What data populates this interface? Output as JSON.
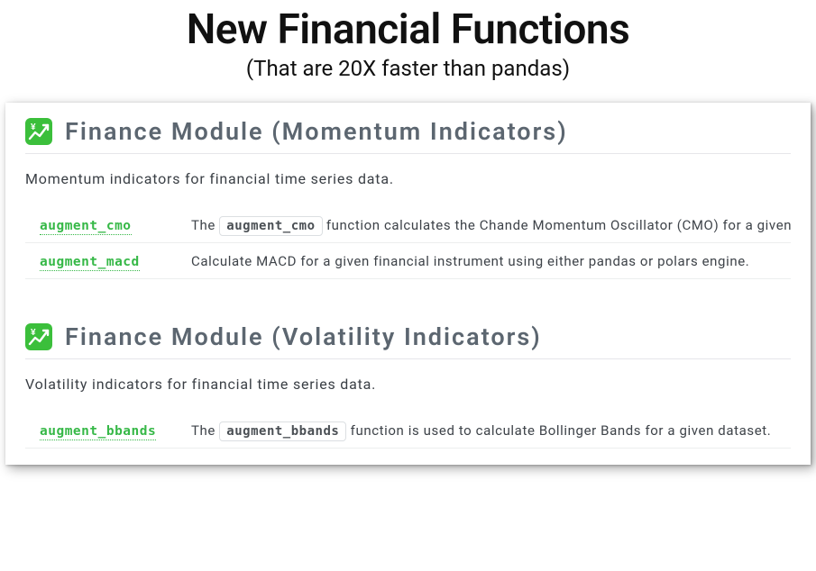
{
  "header": {
    "title": "New Financial Functions",
    "subtitle": "(That are 20X faster than pandas)"
  },
  "sections": [
    {
      "icon": "chart-yen-icon",
      "title": "Finance Module (Momentum Indicators)",
      "description": "Momentum indicators for financial time series data.",
      "functions": [
        {
          "name": "augment_cmo",
          "desc_prefix": "The ",
          "code": "augment_cmo",
          "desc_suffix": " function calculates the Chande Momentum Oscillator (CMO) for a given financial time series."
        },
        {
          "name": "augment_macd",
          "desc_prefix": "",
          "code": "",
          "desc_suffix": "Calculate MACD for a given financial instrument using either pandas or polars engine."
        }
      ]
    },
    {
      "icon": "chart-yen-icon",
      "title": "Finance Module (Volatility Indicators)",
      "description": "Volatility indicators for financial time series data.",
      "functions": [
        {
          "name": "augment_bbands",
          "desc_prefix": "The ",
          "code": "augment_bbands",
          "desc_suffix": " function is used to calculate Bollinger Bands for a given dataset."
        }
      ]
    }
  ]
}
